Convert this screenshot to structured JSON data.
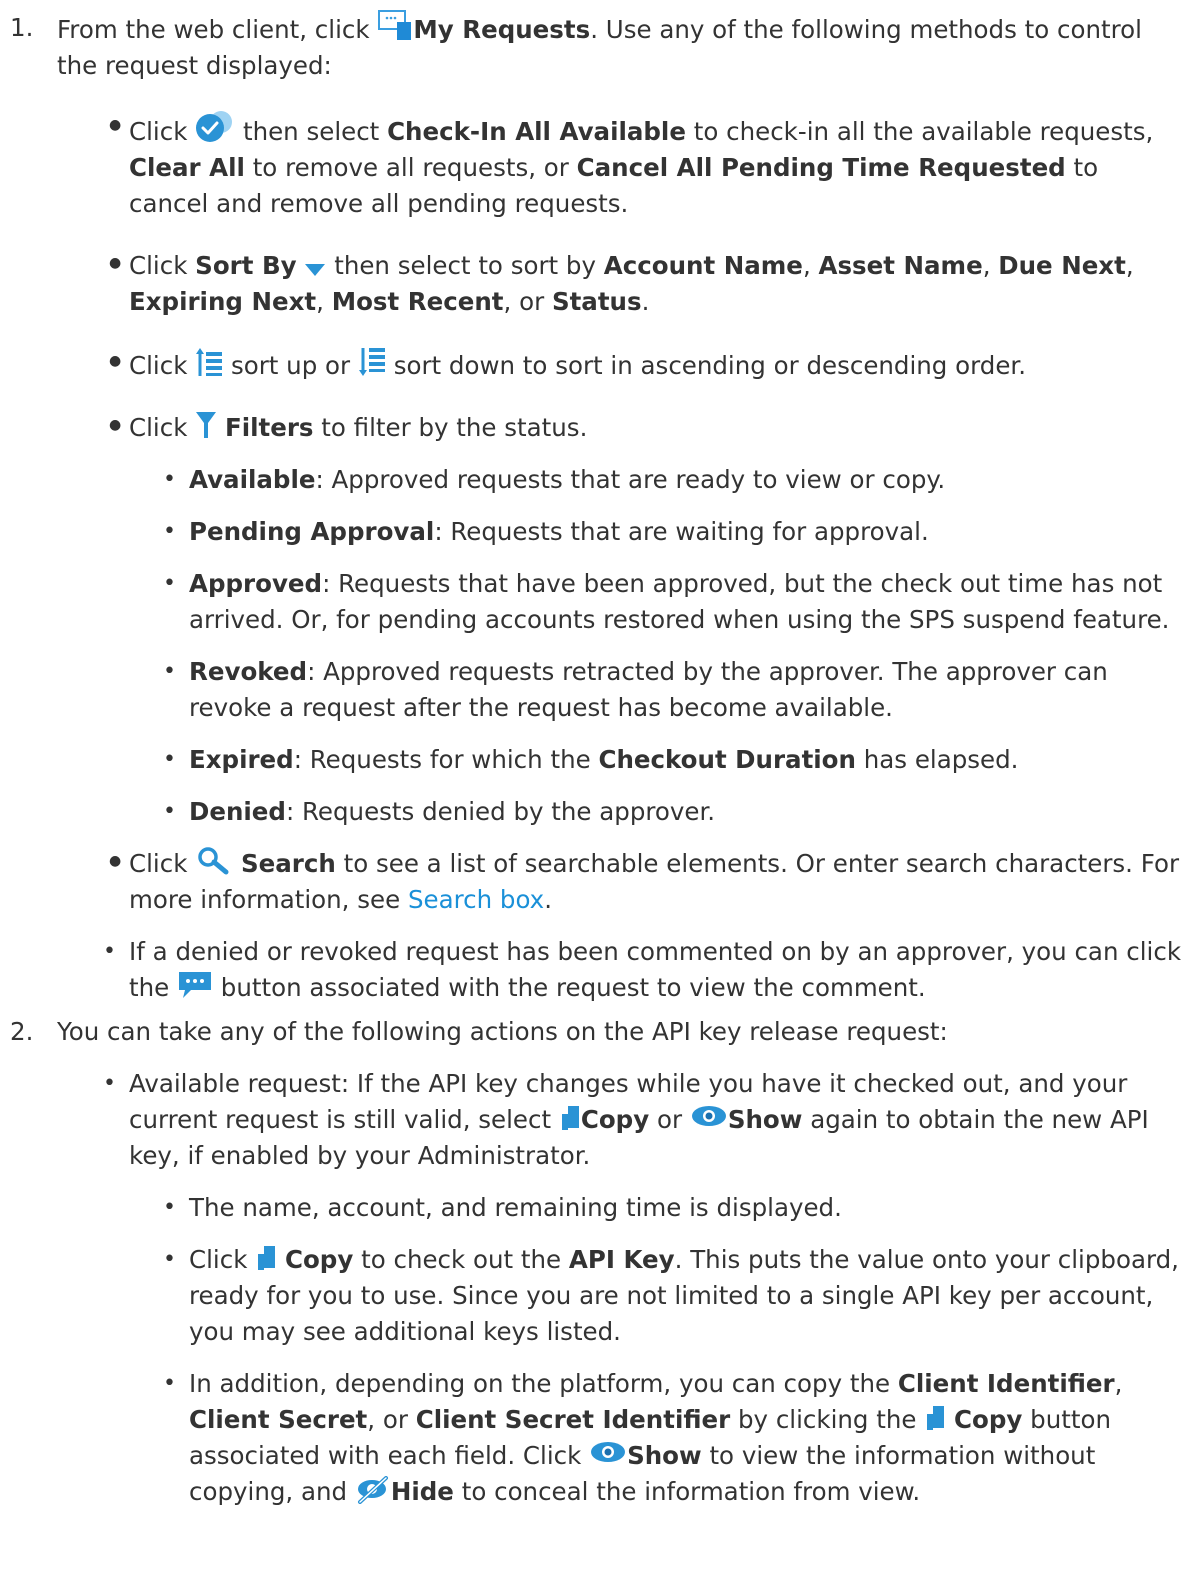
{
  "step1": {
    "number": "1.",
    "pre": "From the web client, click ",
    "title": "My Requests",
    "post": ". Use any of the following methods to control the request displayed:"
  },
  "items": {
    "checkin": {
      "click": "Click ",
      "mid1": " then select ",
      "b1": "Check-In All Available",
      "mid2": " to check-in all the available requests, ",
      "b2": "Clear All",
      "mid3": " to remove all requests, or ",
      "b3": "Cancel All Pending Time Requested",
      "end": " to cancel and remove all pending requests."
    },
    "sortby": {
      "click": "Click ",
      "label": "Sort By",
      "mid": " then select to sort by ",
      "o1": "Account Name",
      "o2": "Asset Name",
      "o3": "Due Next",
      "o4": "Expiring Next",
      "o5": "Most Recent",
      "o6": "Status",
      "sep": ", ",
      "or": ", or ",
      "end": "."
    },
    "sortorder": {
      "click": "Click ",
      "up": " sort up or ",
      "down": " sort down to sort in ascending or descending order."
    },
    "filters": {
      "click": "Click ",
      "label": "Filters",
      "end": " to filter by the status.",
      "statuses": [
        {
          "name": "Available",
          "desc": ": Approved requests that are ready to view or copy."
        },
        {
          "name": "Pending Approval",
          "desc": ": Requests that are waiting for approval."
        },
        {
          "name": "Approved",
          "desc": ": Requests that have been approved, but the check out time has not arrived. Or, for pending accounts restored when using the SPS suspend feature."
        },
        {
          "name": "Revoked",
          "desc": ": Approved requests retracted by the approver. The approver can revoke a request after the request has become available."
        },
        {
          "name": "Expired",
          "desc_pre": ": Requests for which the ",
          "desc_b": "Checkout Duration",
          "desc_post": " has elapsed."
        },
        {
          "name": "Denied",
          "desc": ": Requests denied by the approver."
        }
      ]
    },
    "search": {
      "click": "Click ",
      "label": "Search",
      "mid": " to see a list of searchable elements. Or enter search characters. For more information, see ",
      "link": "Search box",
      "end": "."
    },
    "comment": {
      "pre": "If a denied or revoked request has been commented on by an approver, you can click the ",
      "post": " button associated with the request to view the comment."
    }
  },
  "step2": {
    "number": "2.",
    "text": "You can take any of the following actions on the API key release request:",
    "available": {
      "pre": "Available request: If the API key changes while you have it checked out, and your current request is still valid, select ",
      "copy": "Copy",
      "or": " or ",
      "show": "Show",
      "post": " again to obtain the new API key, if enabled by your Administrator."
    },
    "sub": {
      "displayed": "The name, account, and remaining time is displayed.",
      "copy_click": "Click ",
      "copy_label": "Copy",
      "copy_mid": " to check out the ",
      "copy_b": "API Key",
      "copy_end": ". This puts the value onto your clipboard, ready for you to use. Since you are not limited to a single API key per account, you may see additional keys listed.",
      "add_pre": "In addition, depending on the platform, you can copy the ",
      "add_b1": "Client Identifier",
      "add_sep": ", ",
      "add_b2": "Client Secret",
      "add_or": ", or ",
      "add_b3": "Client Secret Identifier",
      "add_mid": " by clicking the ",
      "add_copy": "Copy",
      "add_mid2": " button associated with each field. Click ",
      "add_show": "Show",
      "add_mid3": " to view the information without copying, and ",
      "add_hide": "Hide",
      "add_end": " to conceal the information from view."
    }
  },
  "colors": {
    "text": "#333333",
    "link": "#1a90d8",
    "icon_blue": "#2a93d5"
  }
}
